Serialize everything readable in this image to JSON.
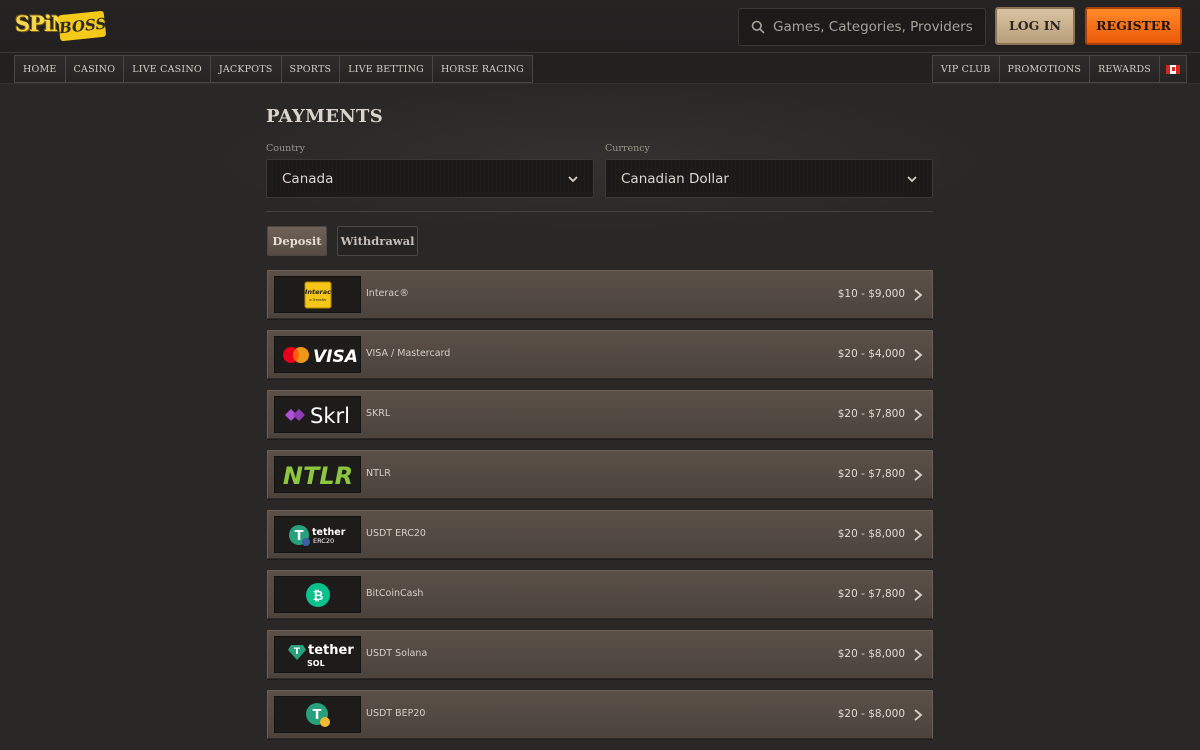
{
  "brand": {
    "logo_word1": "SPiN",
    "logo_word2": "BOSS"
  },
  "search": {
    "placeholder": "Games, Categories, Providers"
  },
  "auth": {
    "login_label": "LOG IN",
    "register_label": "REGISTER"
  },
  "nav": {
    "left": [
      "HOME",
      "CASINO",
      "LIVE CASINO",
      "JACKPOTS",
      "SPORTS",
      "LIVE BETTING",
      "HORSE RACING"
    ],
    "right": [
      "VIP CLUB",
      "PROMOTIONS",
      "REWARDS"
    ]
  },
  "page": {
    "title": "PAYMENTS"
  },
  "filters": {
    "country_label": "Country",
    "country_value": "Canada",
    "currency_label": "Currency",
    "currency_value": "Canadian Dollar"
  },
  "tabs": {
    "deposit": "Deposit",
    "withdrawal": "Withdrawal"
  },
  "methods": [
    {
      "name": "Interac®",
      "range": "$10 - $9,000",
      "logo": "interac-logo",
      "logo_text": "Interac",
      "logo_subtext": "e-Transfer"
    },
    {
      "name": "VISA / Mastercard",
      "range": "$20 - $4,000",
      "logo": "visa-mastercard-logo",
      "logo_text": "VISA"
    },
    {
      "name": "SKRL",
      "range": "$20 - $7,800",
      "logo": "skrill-logo",
      "logo_text": "Skrl"
    },
    {
      "name": "NTLR",
      "range": "$20 - $7,800",
      "logo": "neteller-logo",
      "logo_text": "NTLR"
    },
    {
      "name": "USDT ERC20",
      "range": "$20 - $8,000",
      "logo": "tether-erc20-logo",
      "logo_text": "tether",
      "logo_subtext": "ERC20"
    },
    {
      "name": "BitCoinCash",
      "range": "$20 - $7,800",
      "logo": "bitcoin-cash-logo"
    },
    {
      "name": "USDT Solana",
      "range": "$20 - $8,000",
      "logo": "tether-sol-logo",
      "logo_text": "tether",
      "logo_subtext": "SOL"
    },
    {
      "name": "USDT BEP20",
      "range": "$20 - $8,000",
      "logo": "tether-bep20-logo"
    }
  ],
  "colors": {
    "background": "#2a2827",
    "register": "#f26b12",
    "login": "#c9b08c",
    "row": "#544a42",
    "interac": "#f5c518",
    "skrill": "#8e3bb8",
    "neteller": "#8dc63f",
    "tether": "#26a17b",
    "bitcoin_cash": "#0ac18e"
  }
}
